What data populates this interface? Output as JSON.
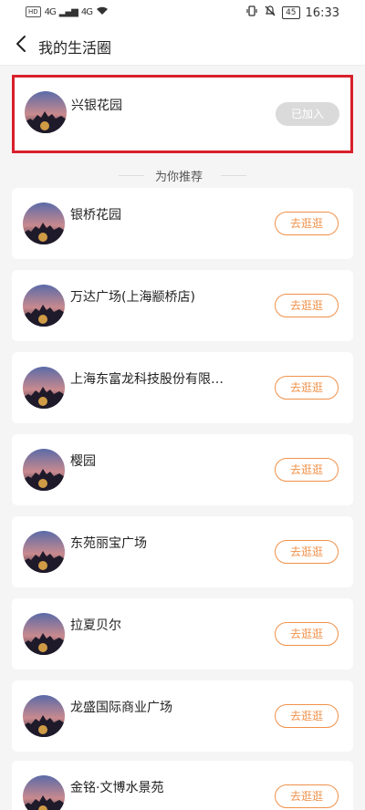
{
  "status_bar": {
    "left_chips": [
      "HD",
      "4G",
      "4G"
    ],
    "signal": "▂▄▆",
    "wifi": "wifi",
    "battery": "45",
    "time": "16:33"
  },
  "nav": {
    "title": "我的生活圈",
    "back_icon": "chevron-left-icon"
  },
  "joined": {
    "name": "兴银花园",
    "button": "已加入"
  },
  "recommend": {
    "header": "为你推荐",
    "items": [
      {
        "name": "银桥花园",
        "button": "去逛逛"
      },
      {
        "name": "万达广场(上海颛桥店)",
        "button": "去逛逛"
      },
      {
        "name": "上海东富龙科技股份有限…",
        "button": "去逛逛"
      },
      {
        "name": "樱园",
        "button": "去逛逛"
      },
      {
        "name": "东苑丽宝广场",
        "button": "去逛逛"
      },
      {
        "name": "拉夏贝尔",
        "button": "去逛逛"
      },
      {
        "name": "龙盛国际商业广场",
        "button": "去逛逛"
      },
      {
        "name": "金铭·文博水景苑",
        "button": "去逛逛"
      }
    ]
  },
  "colors": {
    "accent": "#f0914a",
    "highlight_border": "#d9202c",
    "joined_button_bg": "#dadada"
  }
}
